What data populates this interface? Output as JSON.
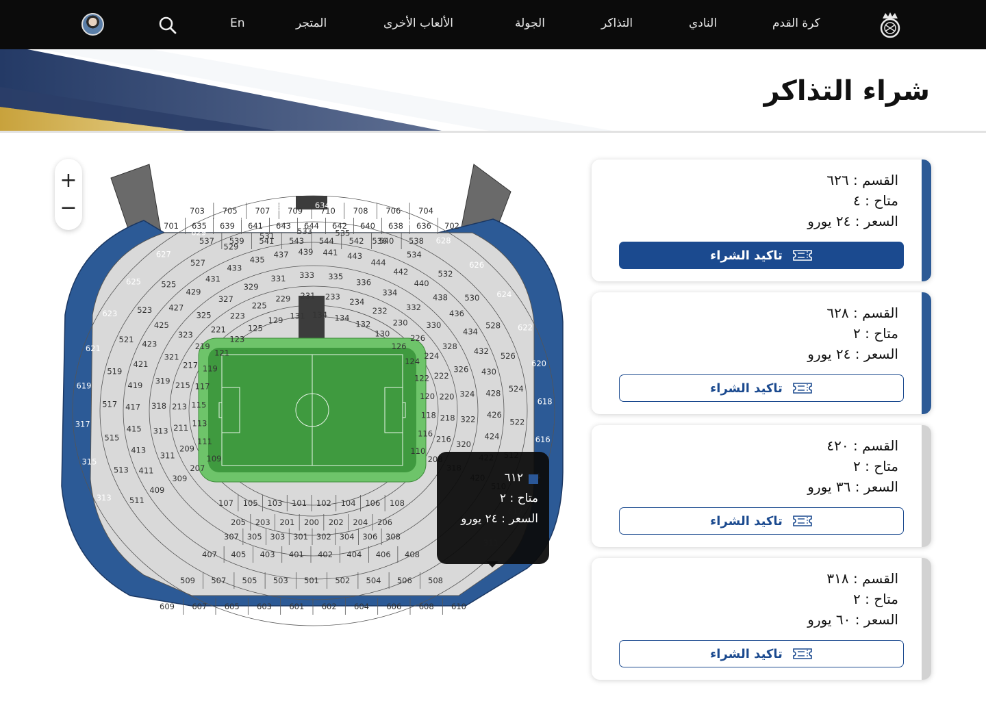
{
  "nav": {
    "items": [
      "كرة القدم",
      "النادي",
      "التذاكر",
      "الجولة",
      "الألعاب الأخرى",
      "المتجر",
      "En"
    ],
    "logo_icon": "real-madrid-crest-icon",
    "search_icon": "search-icon",
    "avatar_icon": "user-avatar"
  },
  "hero": {
    "title": "شراء التذاكر"
  },
  "zoom": {
    "in_label": "+",
    "out_label": "−"
  },
  "tooltip": {
    "section": "٦١٢",
    "available": "متاح : ٢",
    "price": "السعر :  ٢٤ يورو",
    "color": "#2a5798"
  },
  "cards": [
    {
      "section": "القسم : ٦٢٦",
      "available": "متاح : ٤",
      "price": "السعر :  ٢٤ يورو",
      "button": "تاكيد الشراء",
      "accent": "#2c5a96",
      "primary": true
    },
    {
      "section": "القسم : ٦٢٨",
      "available": "متاح : ٢",
      "price": "السعر :  ٢٤ يورو",
      "button": "تاكيد الشراء",
      "accent": "#2c5a96",
      "primary": false
    },
    {
      "section": "القسم : ٤٢٠",
      "available": "متاح : ٢",
      "price": "السعر :  ٣٦ يورو",
      "button": "تاكيد الشراء",
      "accent": "#d2d2d2",
      "primary": false
    },
    {
      "section": "القسم : ٣١٨",
      "available": "متاح : ٢",
      "price": "السعر : ٦٠ يورو",
      "button": "تاكيد الشراء",
      "accent": "#d2d2d2",
      "primary": false
    }
  ],
  "stadium": {
    "ring_outer": [
      "313",
      "315",
      "317",
      "619",
      "621",
      "623",
      "625",
      "627",
      "629",
      "631",
      "633",
      "634",
      "632",
      "630",
      "628",
      "626",
      "624",
      "622",
      "620",
      "618",
      "616",
      "614",
      "612",
      "311"
    ],
    "ring_500": [
      "511",
      "513",
      "515",
      "517",
      "519",
      "521",
      "523",
      "525",
      "527",
      "529",
      "531",
      "533",
      "535",
      "536",
      "534",
      "532",
      "530",
      "528",
      "526",
      "524",
      "522",
      "512",
      "510"
    ],
    "ring_400": [
      "409",
      "411",
      "413",
      "415",
      "417",
      "419",
      "421",
      "423",
      "425",
      "427",
      "429",
      "431",
      "433",
      "435",
      "437",
      "439",
      "441",
      "443",
      "444",
      "442",
      "440",
      "438",
      "436",
      "434",
      "432",
      "430",
      "428",
      "426",
      "424",
      "422",
      "420"
    ],
    "ring_300": [
      "309",
      "311",
      "313",
      "318",
      "319",
      "321",
      "323",
      "325",
      "327",
      "329",
      "331",
      "333",
      "335",
      "336",
      "334",
      "332",
      "330",
      "328",
      "326",
      "324",
      "322",
      "320",
      "318"
    ],
    "ring_200": [
      "207",
      "209",
      "211",
      "213",
      "215",
      "217",
      "219",
      "221",
      "223",
      "225",
      "229",
      "231",
      "233",
      "234",
      "232",
      "230",
      "226",
      "224",
      "222",
      "220",
      "218",
      "216",
      "208"
    ],
    "ring_100": [
      "109",
      "111",
      "113",
      "115",
      "117",
      "119",
      "121",
      "123",
      "125",
      "129",
      "131",
      "134",
      "134",
      "132",
      "130",
      "126",
      "124",
      "122",
      "120",
      "118",
      "116",
      "110"
    ],
    "bottom_100": [
      "107",
      "105",
      "103",
      "101",
      "102",
      "104",
      "106",
      "108"
    ],
    "bottom_200": [
      "205",
      "203",
      "201",
      "200",
      "202",
      "204",
      "206"
    ],
    "bottom_300": [
      "307",
      "305",
      "303",
      "301",
      "302",
      "304",
      "306",
      "308"
    ],
    "bottom_400": [
      "407",
      "405",
      "403",
      "401",
      "402",
      "404",
      "406",
      "408"
    ],
    "bottom_500": [
      "509",
      "507",
      "505",
      "503",
      "501",
      "502",
      "504",
      "506",
      "508"
    ],
    "bottom_600": [
      "609",
      "607",
      "605",
      "603",
      "601",
      "602",
      "604",
      "606",
      "608",
      "610"
    ],
    "top_600": [
      "701",
      "635",
      "639",
      "641",
      "643",
      "644",
      "642",
      "640",
      "638",
      "636",
      "702"
    ],
    "top_700": [
      "703",
      "705",
      "707",
      "709",
      "710",
      "708",
      "706",
      "704"
    ],
    "top_500": [
      "537",
      "539",
      "541",
      "543",
      "544",
      "542",
      "540",
      "538"
    ],
    "colors": {
      "blue": "#2c5a96",
      "grey": "#d9d9d9",
      "dark": "#3c3c3c",
      "pitch": "#4caf50"
    }
  }
}
